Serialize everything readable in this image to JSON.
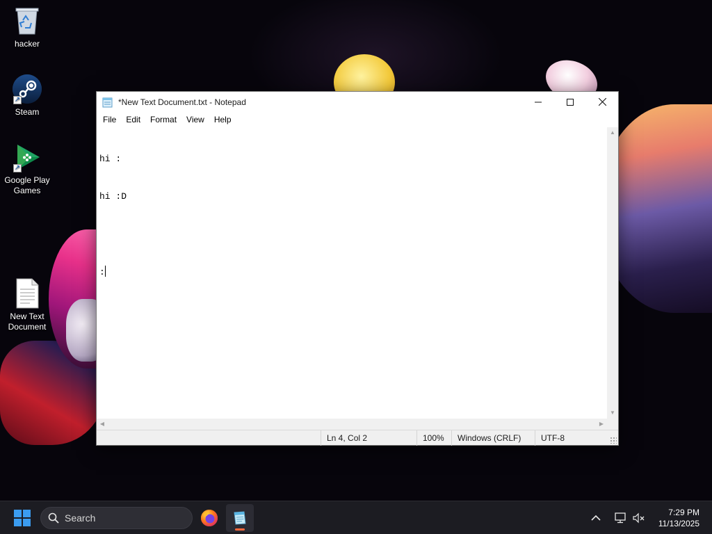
{
  "desktop": {
    "icons": [
      {
        "label": "hacker",
        "icon": "recycle-bin-icon"
      },
      {
        "label": "Steam",
        "icon": "steam-icon"
      },
      {
        "label": "Google Play\nGames",
        "icon": "google-play-games-icon"
      },
      {
        "label": "New Text\nDocument",
        "icon": "text-document-icon"
      }
    ]
  },
  "notepad": {
    "title": "*New Text Document.txt - Notepad",
    "menu": [
      "File",
      "Edit",
      "Format",
      "View",
      "Help"
    ],
    "content_lines": [
      "hi :",
      "hi :D",
      "",
      ":"
    ],
    "status": {
      "position": "Ln 4, Col 2",
      "zoom": "100%",
      "line_ending": "Windows (CRLF)",
      "encoding": "UTF-8"
    }
  },
  "taskbar": {
    "search_label": "Search",
    "time": "7:29 PM",
    "date": "11/13/2025",
    "apps": [
      "firefox-icon",
      "notepad-icon"
    ]
  },
  "colors": {
    "accent_indicator": "#ff6a3d",
    "taskbar_bg": "#1c1c22",
    "start_blue": "#3b9cf0"
  }
}
